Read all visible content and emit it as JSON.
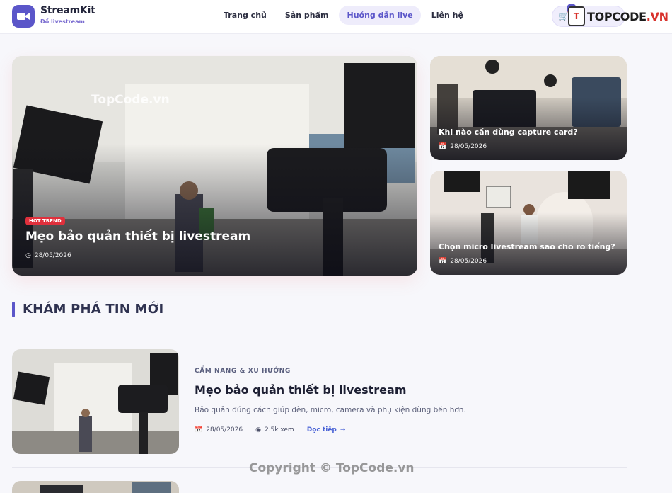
{
  "header": {
    "brand": "StreamKit",
    "tagline": "Đồ livestream",
    "nav": [
      "Trang chủ",
      "Sản phẩm",
      "Hướng dẫn live",
      "Liên hệ"
    ],
    "active_nav": "Hướng dẫn live",
    "cart_count": "0"
  },
  "watermark": {
    "logo_prefix": "T",
    "logo_main": "TOPCODE",
    "logo_suffix": ".VN",
    "hero_text": "TopCode.vn",
    "copyright": "Copyright © TopCode.vn"
  },
  "hero": {
    "badge": "HOT TREND",
    "title": "Mẹo bảo quản thiết bị livestream",
    "date": "28/05/2026"
  },
  "side_posts": [
    {
      "title": "Khi nào cần dùng capture card?",
      "date": "28/05/2026"
    },
    {
      "title": "Chọn micro livestream sao cho rõ tiếng?",
      "date": "28/05/2026"
    }
  ],
  "section": {
    "title": "KHÁM PHÁ TIN MỚI"
  },
  "article": {
    "category": "CẨM NANG & XU HƯỚNG",
    "title": "Mẹo bảo quản thiết bị livestream",
    "description": "Bảo quản đúng cách giúp đèn, micro, camera và phụ kiện dùng bền hơn.",
    "date": "28/05/2026",
    "views": "2.5k xem",
    "read_more": "Đọc tiếp"
  },
  "colors": {
    "accent": "#5b56c9",
    "hot": "#e0303c",
    "link": "#4a63d6"
  }
}
